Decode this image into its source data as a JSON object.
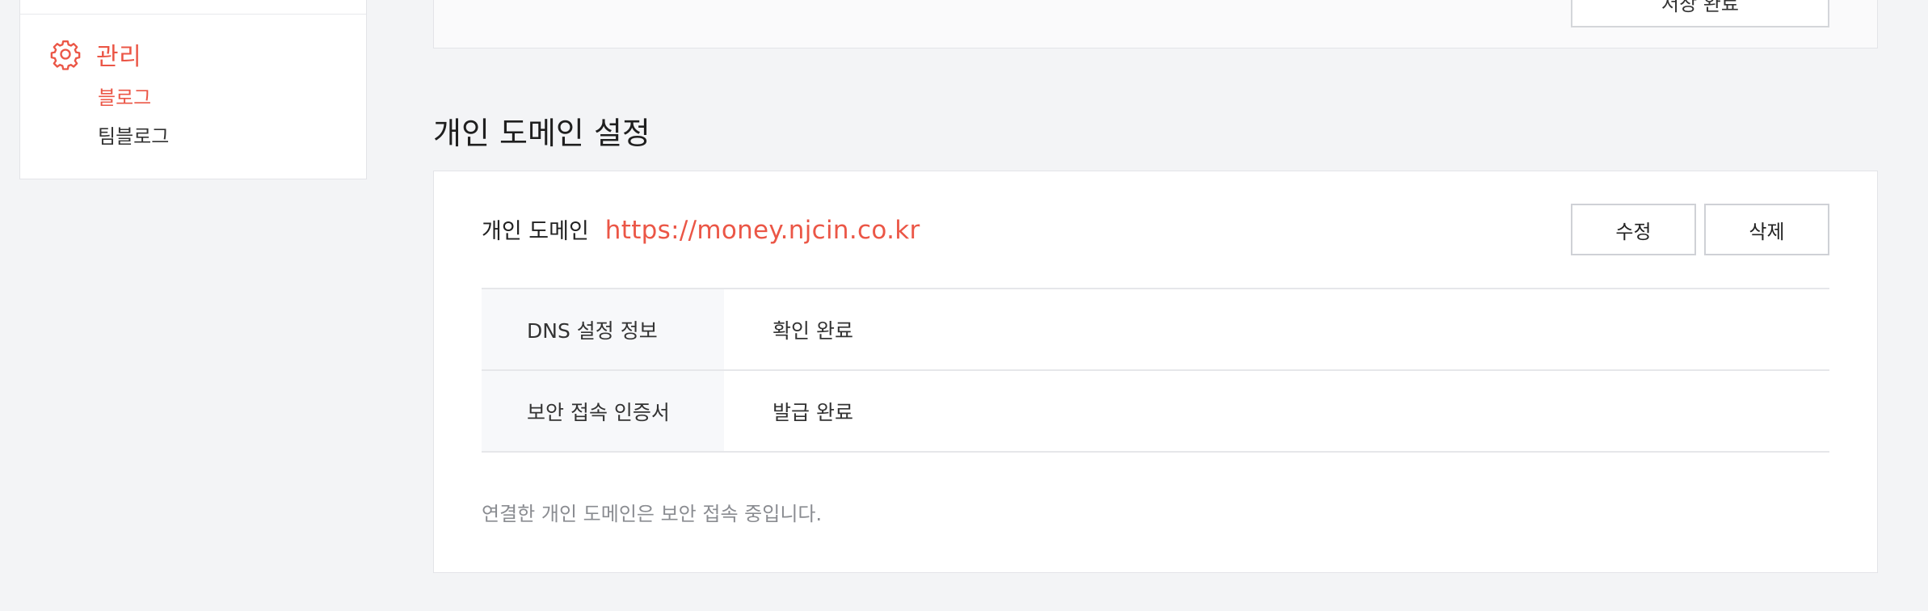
{
  "sidebar": {
    "section_title": "관리",
    "section_icon": "gear-icon",
    "items": [
      {
        "label": "블로그",
        "active": true
      },
      {
        "label": "팀블로그",
        "active": false
      }
    ]
  },
  "top_card": {
    "button_label": "저장 완료"
  },
  "custom_domain": {
    "section_title": "개인 도메인 설정",
    "label": "개인 도메인",
    "url": "https://money.njcin.co.kr",
    "edit_label": "수정",
    "delete_label": "삭제",
    "info": [
      {
        "key": "DNS 설정 정보",
        "value": "확인 완료"
      },
      {
        "key": "보안 접속 인증서",
        "value": "발급 완료"
      }
    ],
    "note": "연결한 개인 도메인은 보안 접속 중입니다."
  },
  "colors": {
    "accent": "#eb5646",
    "background": "#f3f4f6",
    "card": "#ffffff",
    "border": "#e3e4e8",
    "muted_text": "#8a8c91"
  }
}
